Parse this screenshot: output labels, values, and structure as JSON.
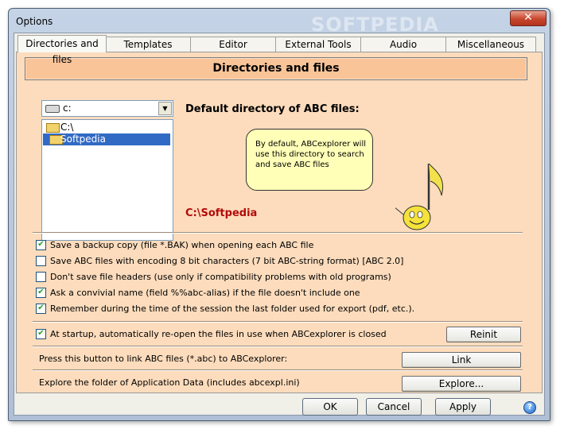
{
  "window": {
    "title": "Options",
    "watermark": "SOFTPEDIA",
    "close_symbol": "✕"
  },
  "tabs": [
    {
      "label": "Directories and files"
    },
    {
      "label": "Templates"
    },
    {
      "label": "Editor"
    },
    {
      "label": "External Tools"
    },
    {
      "label": "Audio"
    },
    {
      "label": "Miscellaneous"
    }
  ],
  "panel": {
    "header": "Directories and files",
    "drive": {
      "value": "c:"
    },
    "dirs": [
      {
        "label": "C:\\"
      },
      {
        "label": "Softpedia"
      }
    ],
    "default_label": "Default directory of ABC files:",
    "bubble_text": "By default, ABCexplorer will use this directory to search and save ABC files",
    "current_path": "C:\\Softpedia",
    "options": [
      {
        "label": "Save a backup copy (file *.BAK) when opening each ABC file",
        "checked": true
      },
      {
        "label": "Save ABC files with encoding 8 bit characters (7 bit ABC-string format) [ABC 2.0]",
        "checked": false
      },
      {
        "label": "Don't save file headers (use only if compatibility problems with old programs)",
        "checked": false
      },
      {
        "label": "Ask a convivial name (field %%abc-alias) if the file doesn't include one",
        "checked": true
      },
      {
        "label": "Remember during the time of the session the last folder used for export (pdf, etc.).",
        "checked": true
      }
    ],
    "startup": {
      "label": "At startup, automatically re-open the files in use when ABCexplorer is closed",
      "checked": true,
      "button": "Reinit"
    },
    "link": {
      "label": "Press this button to link ABC files (*.abc) to ABCexplorer:",
      "button": "Link"
    },
    "explore": {
      "label": "Explore the folder of Application Data (includes abcexpl.ini)",
      "button": "Explore..."
    }
  },
  "footer": {
    "ok": "OK",
    "cancel": "Cancel",
    "apply": "Apply",
    "help": "?"
  },
  "check_glyph": "✔",
  "combo_arrow": "▼",
  "colors": {
    "header_bg": "#f9c498",
    "panel_bg": "#fcdcbc",
    "path_red": "#b20a0a",
    "bubble_bg": "#ffffb8",
    "selection": "#316ac5"
  }
}
